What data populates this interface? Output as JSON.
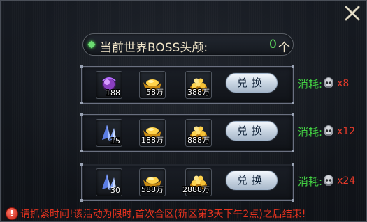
{
  "header": {
    "title": "当前世界BOSS头颅:",
    "count": "0",
    "unit": "个"
  },
  "cost_label": "消耗:",
  "exchange_label": "兑换",
  "rows": [
    {
      "items": [
        {
          "icon": "purple-orb-icon",
          "qty": "188"
        },
        {
          "icon": "gold-ingot-icon",
          "qty": "58万"
        },
        {
          "icon": "gold-coin-pile-icon",
          "qty": "388万"
        }
      ],
      "cost_times": "x8"
    },
    {
      "items": [
        {
          "icon": "blue-crystal-icon",
          "qty": "15"
        },
        {
          "icon": "gold-ingot-icon",
          "qty": "188万"
        },
        {
          "icon": "gold-coin-pile-icon",
          "qty": "888万"
        }
      ],
      "cost_times": "x12"
    },
    {
      "items": [
        {
          "icon": "blue-crystal-icon",
          "qty": "30"
        },
        {
          "icon": "gold-ingot-icon",
          "qty": "588万"
        },
        {
          "icon": "gold-coin-pile-icon",
          "qty": "2888万"
        }
      ],
      "cost_times": "x24"
    }
  ],
  "notice": "请抓紧时间!该活动为限时,首次合区(新区第3天下午2点)之后结束!",
  "colors": {
    "cost_label": "#43d243",
    "cost_times": "#e53a2a",
    "count": "#5fe05f",
    "notice": "#e8331f",
    "title": "#f2e6c9"
  }
}
